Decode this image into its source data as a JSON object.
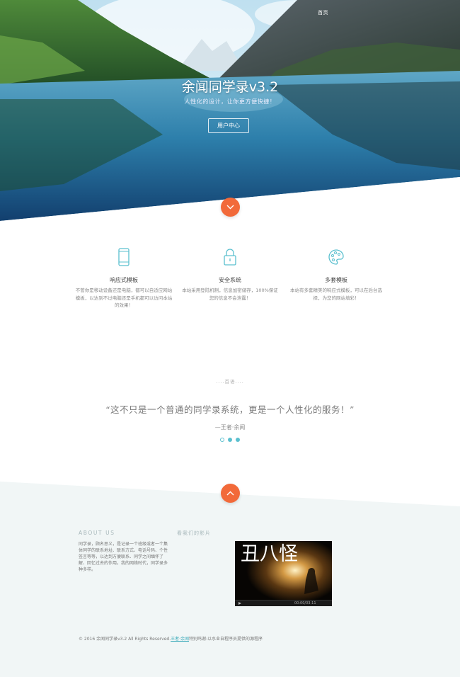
{
  "nav": {
    "home": "首页"
  },
  "hero": {
    "title": "余闻同学录v3.2",
    "subtitle": "人性化的设计，让你更方便快捷！",
    "button": "用户中心"
  },
  "features": [
    {
      "icon": "mobile-phone-icon",
      "title": "响应式模板",
      "desc": "不管你是移动设备还是电脑，都可以自适应网站模板，以达到不过电脑还是手机都可以访问本站的效果！"
    },
    {
      "icon": "lock-icon",
      "title": "安全系统",
      "desc": "本站采用登陆机制，信息加密储存，100%保证您的信息不会泄露！"
    },
    {
      "icon": "palette-icon",
      "title": "多套模板",
      "desc": "本站有多套精美的响应式模板，可以在后台选择，为您的网站填彩！"
    }
  ],
  "quote": {
    "tag": "....首语....",
    "text": "“这不只是一个普通的同学录系统，更是一个人性化的服务！”",
    "author": "—王者·余闻",
    "active_dot": 0
  },
  "footer": {
    "about_heading": "ABOUT US",
    "about_text": "同学录，顾名思义，是记录一个班级或者一个集体同学的联系地址、联系方式、电话号码、个性签言等等，以达到方便联系、同学之间缅怀了解、回忆过去的作用。我的网络时代，同学录多种多样。",
    "video_heading": "看我们的影片",
    "video_title": "丑八怪",
    "video_time": "00:00/03:11",
    "copyright_prefix": "© 2016 余闻同学录v3.2 All Rights Reserved.",
    "copyright_link": "王者·余闻",
    "copyright_suffix": "特别鸣谢:以水业自程序员提供的源程序"
  },
  "colors": {
    "accent": "#f26a3a",
    "teal": "#5bc0cf",
    "footer_bg": "#f1f6f6"
  }
}
